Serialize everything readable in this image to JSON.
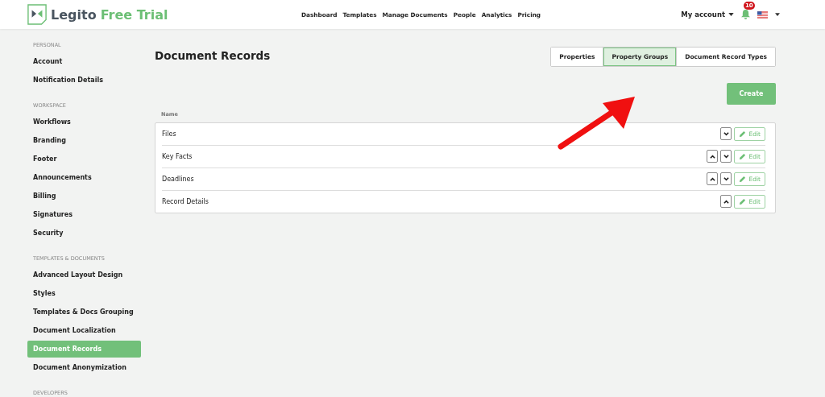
{
  "header": {
    "brand": {
      "name": "Legito",
      "suffix": "Free Trial"
    },
    "nav": [
      "Dashboard",
      "Templates",
      "Manage Documents",
      "People",
      "Analytics",
      "Pricing"
    ],
    "account": "My account",
    "notification_count": "10"
  },
  "sidebar": [
    {
      "heading": "PERSONAL",
      "items": [
        {
          "label": "Account",
          "selected": false
        },
        {
          "label": "Notification Details",
          "selected": false
        }
      ]
    },
    {
      "heading": "WORKSPACE",
      "items": [
        {
          "label": "Workflows",
          "selected": false
        },
        {
          "label": "Branding",
          "selected": false
        },
        {
          "label": "Footer",
          "selected": false
        },
        {
          "label": "Announcements",
          "selected": false
        },
        {
          "label": "Billing",
          "selected": false
        },
        {
          "label": "Signatures",
          "selected": false
        },
        {
          "label": "Security",
          "selected": false
        }
      ]
    },
    {
      "heading": "TEMPLATES & DOCUMENTS",
      "items": [
        {
          "label": "Advanced Layout Design",
          "selected": false
        },
        {
          "label": "Styles",
          "selected": false
        },
        {
          "label": "Templates & Docs Grouping",
          "selected": false
        },
        {
          "label": "Document Localization",
          "selected": false
        },
        {
          "label": "Document Records",
          "selected": true
        },
        {
          "label": "Document Anonymization",
          "selected": false
        }
      ]
    },
    {
      "heading": "DEVELOPERS"
    }
  ],
  "page": {
    "title": "Document Records",
    "tabs": [
      {
        "label": "Properties",
        "selected": false
      },
      {
        "label": "Property Groups",
        "selected": true
      },
      {
        "label": "Document Record Types",
        "selected": false
      }
    ],
    "create_button": "Create",
    "table": {
      "column": "Name",
      "rows": [
        {
          "name": "Files",
          "can_move_up": false,
          "can_move_down": true,
          "edit": "Edit"
        },
        {
          "name": "Key Facts",
          "can_move_up": true,
          "can_move_down": true,
          "edit": "Edit"
        },
        {
          "name": "Deadlines",
          "can_move_up": true,
          "can_move_down": true,
          "edit": "Edit"
        },
        {
          "name": "Record Details",
          "can_move_up": true,
          "can_move_down": false,
          "edit": "Edit"
        }
      ]
    }
  }
}
